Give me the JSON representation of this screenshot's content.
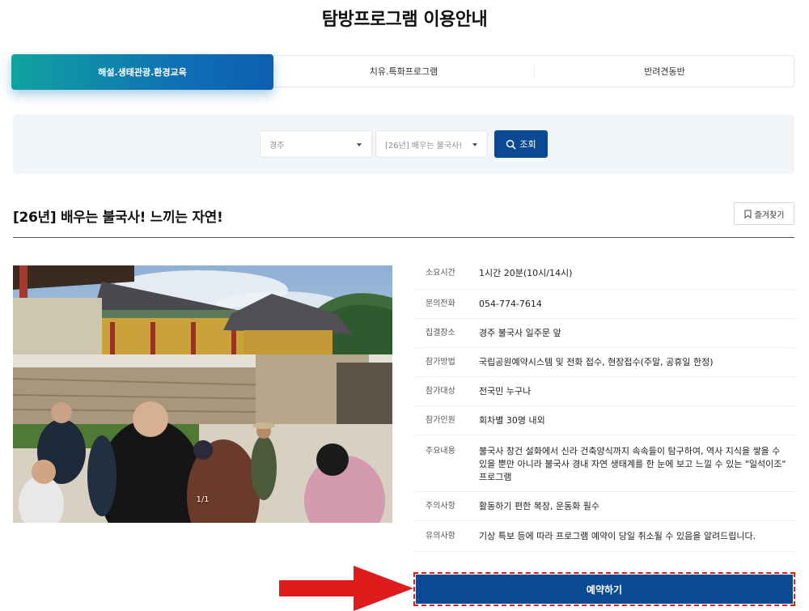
{
  "page": {
    "title": "탐방프로그램 이용안내"
  },
  "tabs": [
    {
      "label": "해설.생태관광.환경교육",
      "active": true
    },
    {
      "label": "치유.특화프로그램",
      "active": false
    },
    {
      "label": "반려견동반",
      "active": false
    }
  ],
  "search": {
    "region_value": "경주",
    "program_value": "[26년] 배우는 불국사!",
    "button_label": "조회"
  },
  "program": {
    "title": "[26년] 배우는 불국사! 느끼는 자연!",
    "bookmark_label": "즐겨찾기",
    "image_counter": "1/1"
  },
  "details": [
    {
      "label": "소요시간",
      "value": "1시간 20분(10시/14시)"
    },
    {
      "label": "문의전화",
      "value": "054-774-7614"
    },
    {
      "label": "집결장소",
      "value": "경주 불국사 일주문 앞"
    },
    {
      "label": "참가방법",
      "value": "국립공원예약시스템 및 전화 접수, 현장접수(주말, 공휴일 한정)"
    },
    {
      "label": "참가대상",
      "value": "전국민 누구나"
    },
    {
      "label": "참가인원",
      "value": "회차별 30명 내외"
    },
    {
      "label": "주요내용",
      "value": "불국사 창건 설화에서 신라 건축양식까지 속속들이 탐구하여, 역사 지식을 쌓을 수 있을 뿐만 아니라 불국사 경내 자연 생태계를 한 눈에 보고 느낄 수 있는 \"일석이조\" 프로그램"
    },
    {
      "label": "주의사항",
      "value": "활동하기 편한 복장, 운동화 필수"
    },
    {
      "label": "유의사항",
      "value": "기상 특보 등에 따라 프로그램 예약이 당일 취소될 수 있음을 알려드립니다."
    }
  ],
  "reserve": {
    "label": "예약하기"
  },
  "colors": {
    "primary": "#0a4a93",
    "tab_gradient_start": "#10a3a0",
    "annotation_red": "#e01b1b"
  },
  "icons": {
    "search": "search-icon",
    "bookmark": "bookmark-icon",
    "caret": "chevron-down-icon"
  }
}
